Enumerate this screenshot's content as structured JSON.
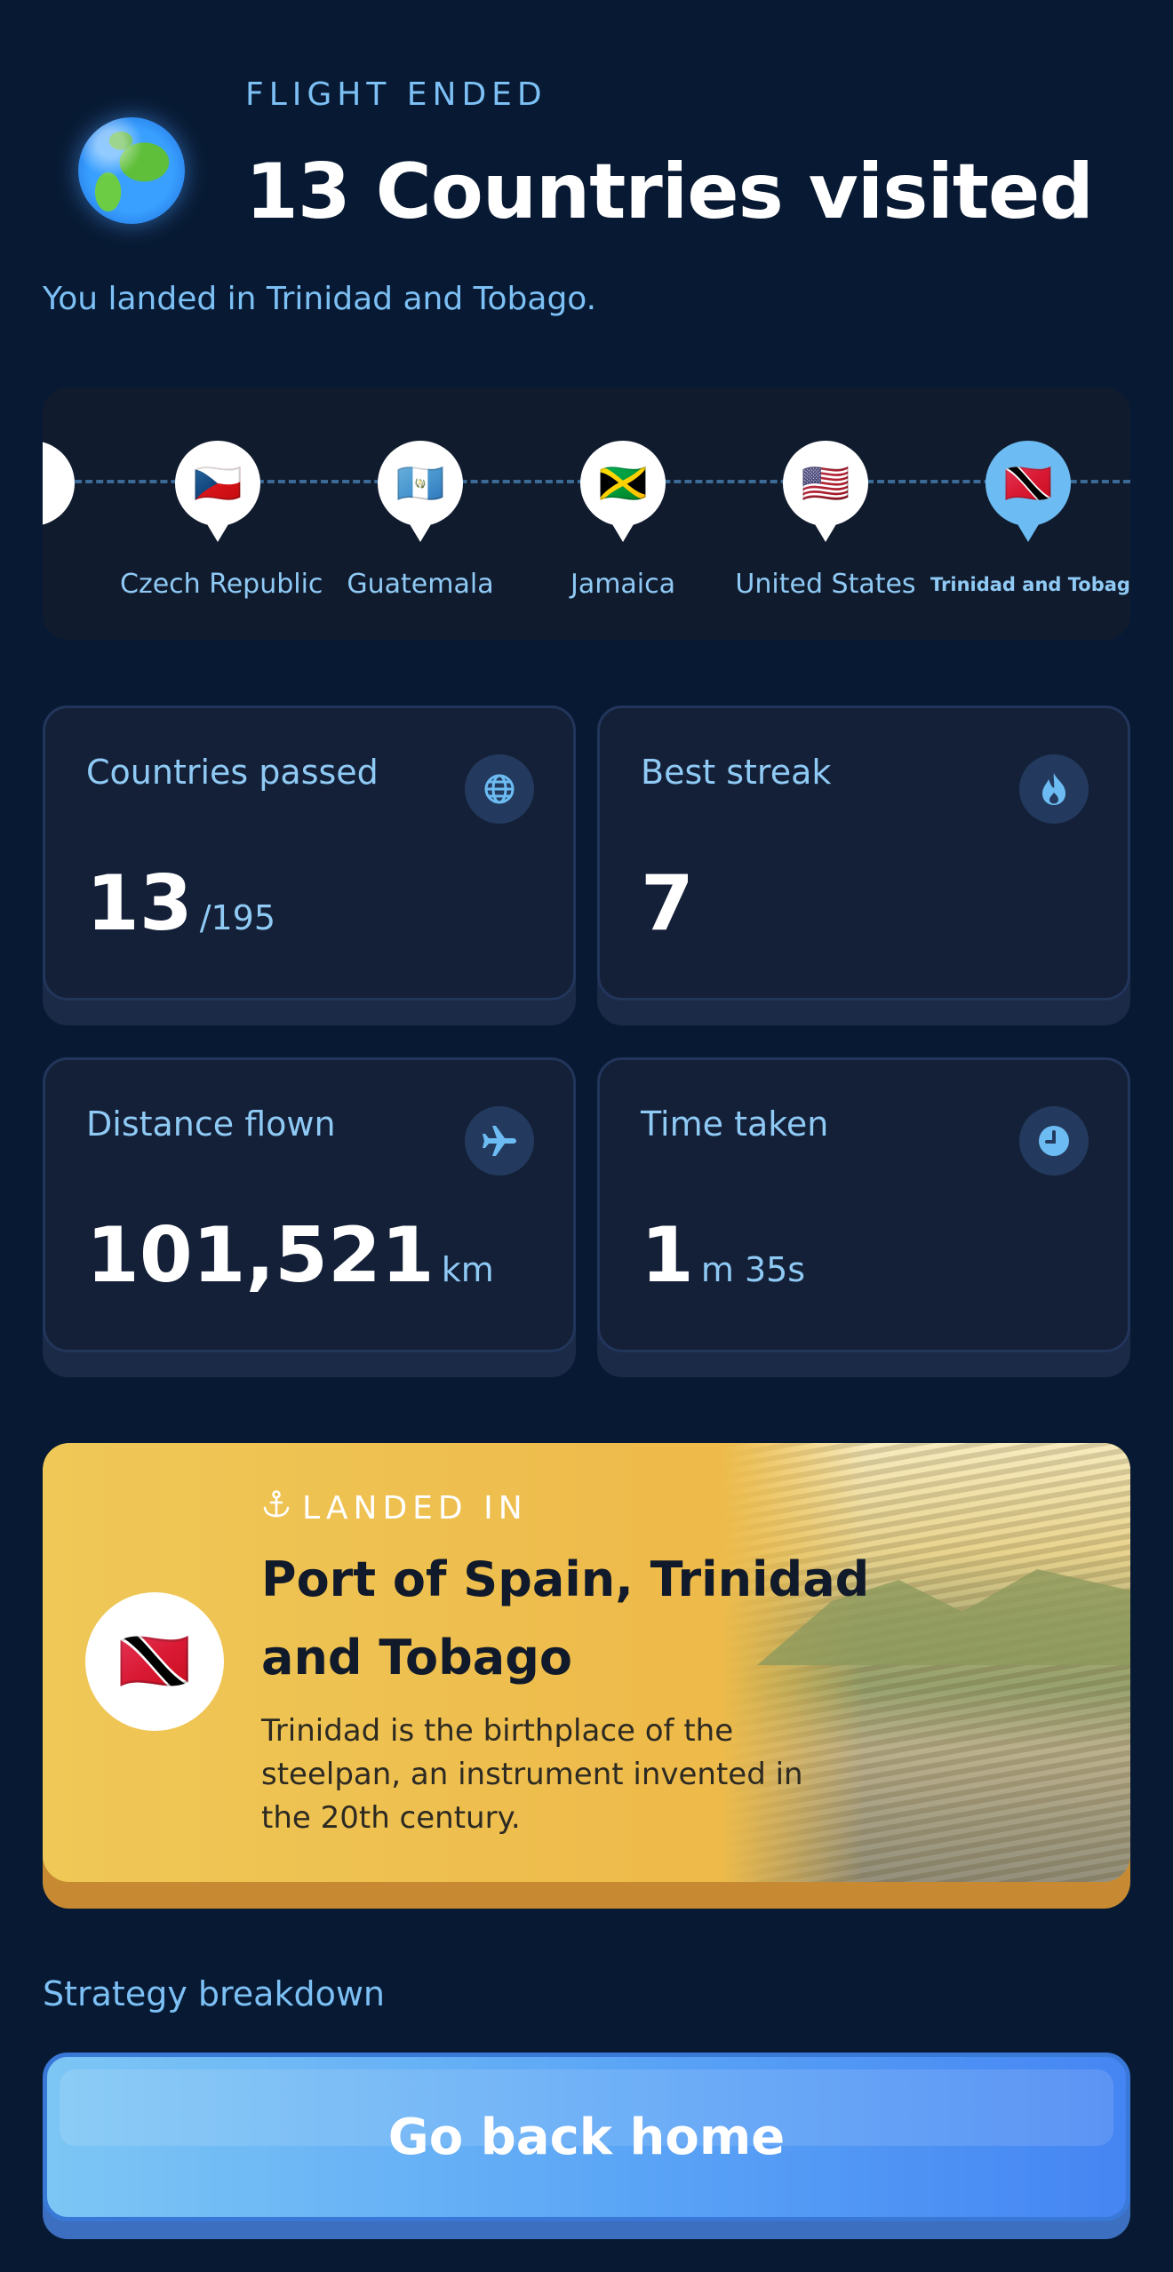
{
  "header": {
    "globe_icon": "earth-globe-icon",
    "eyebrow": "FLIGHT ENDED",
    "title": "13 Countries visited",
    "subtitle": "You landed in Trinidad and Tobago."
  },
  "timeline": {
    "stops": [
      {
        "name": "Czech Republic",
        "flag": "🇨🇿",
        "active": false
      },
      {
        "name": "Guatemala",
        "flag": "🇬🇹",
        "active": false
      },
      {
        "name": "Jamaica",
        "flag": "🇯🇲",
        "active": false
      },
      {
        "name": "United States",
        "flag": "🇺🇸",
        "active": false
      },
      {
        "name": "Trinidad and Tobago",
        "flag": "🇹🇹",
        "active": true
      }
    ]
  },
  "stats": {
    "countries": {
      "label": "Countries passed",
      "value": "13",
      "unit": "/195",
      "icon": "globe-icon"
    },
    "streak": {
      "label": "Best streak",
      "value": "7",
      "unit": "",
      "icon": "flame-icon"
    },
    "distance": {
      "label": "Distance flown",
      "value": "101,521",
      "unit": "km",
      "icon": "airplane-icon"
    },
    "time": {
      "label": "Time taken",
      "value": "1",
      "unit": "m 35s",
      "icon": "clock-icon"
    }
  },
  "landed": {
    "kicker": "LANDED IN",
    "place": "Port of Spain, Trinidad and Tobago",
    "fact": "Trinidad is the birthplace of the steelpan, an instrument invented in the 20th century.",
    "flag": "🇹🇹"
  },
  "footer": {
    "strategy_label": "Strategy breakdown",
    "home_button": "Go back home"
  },
  "colors": {
    "background": "#081a33",
    "accent_blue": "#7cc0f5",
    "card": "#142038",
    "landed_card": "#eeba4a",
    "button": "#5aa4f6"
  }
}
